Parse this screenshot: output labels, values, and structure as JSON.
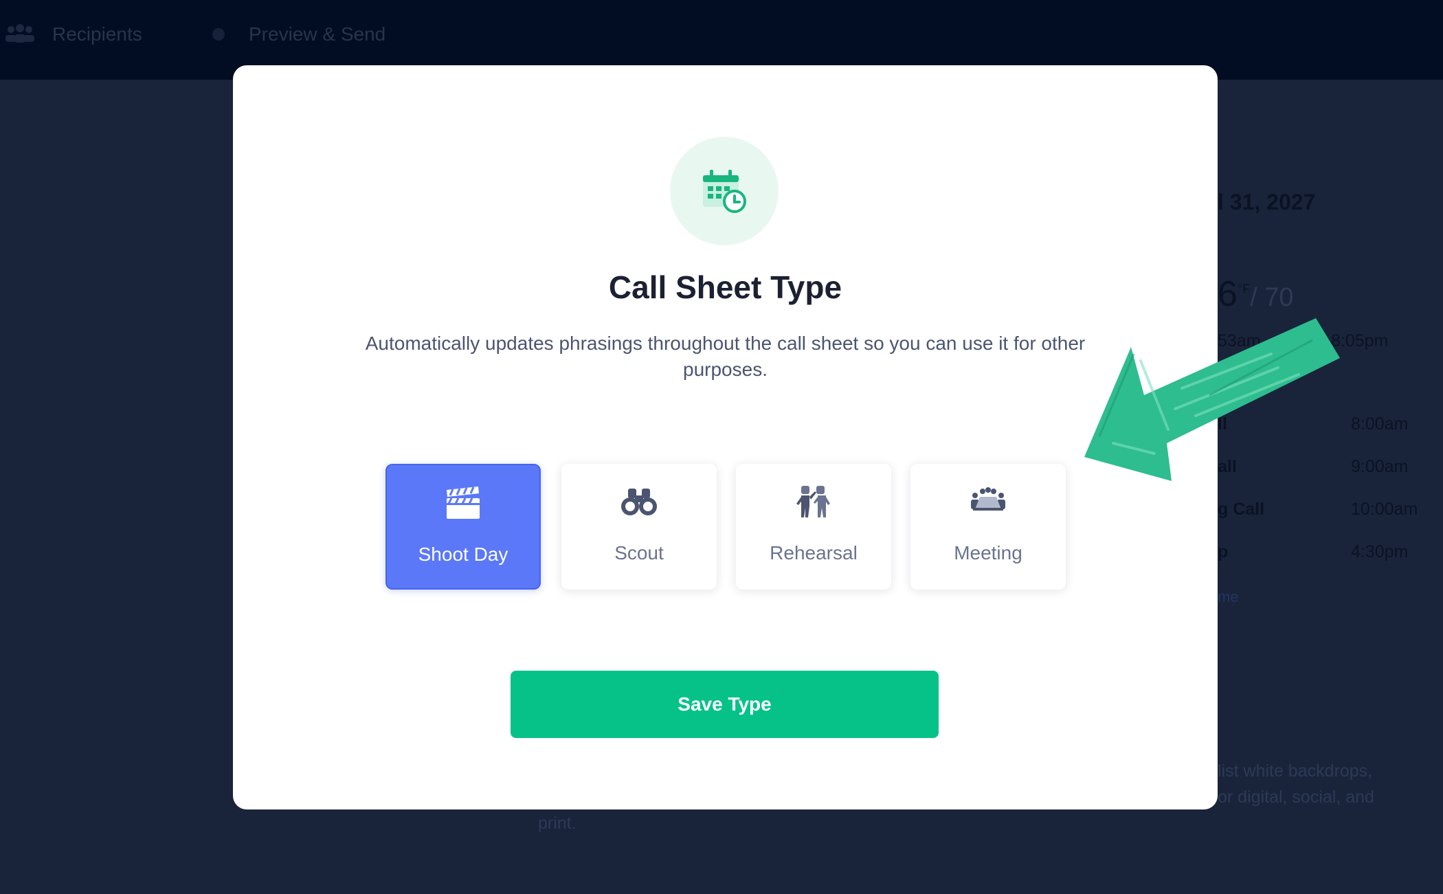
{
  "topbar": {
    "steps": [
      {
        "label": "Recipients",
        "icon": "people-icon"
      },
      {
        "label": "Preview & Send",
        "icon": "dot-icon"
      }
    ]
  },
  "background": {
    "date_fragment": "l 31, 2027",
    "temp_main": "6",
    "temp_unit": "°F",
    "temp_low": "/ 70",
    "sunrise": "53am",
    "sunset": "8:05pm",
    "schedule": [
      {
        "label": "ll",
        "time": "8:00am"
      },
      {
        "label": "all",
        "time": "9:00am"
      },
      {
        "label": "g Call",
        "time": "10:00am"
      },
      {
        "label": "p",
        "time": "4:30pm"
      }
    ],
    "link_fragment": "me",
    "notes_line1": "list white backdrops,",
    "notes_line2": "or digital, social, and",
    "notes_line3": "print."
  },
  "modal": {
    "icon": "calendar-clock-icon",
    "title": "Call Sheet Type",
    "description": "Automatically updates phrasings throughout the call sheet so you can use it for other purposes.",
    "options": [
      {
        "label": "Shoot Day",
        "icon": "clapperboard-icon",
        "selected": true
      },
      {
        "label": "Scout",
        "icon": "binoculars-icon",
        "selected": false
      },
      {
        "label": "Rehearsal",
        "icon": "actors-icon",
        "selected": false
      },
      {
        "label": "Meeting",
        "icon": "meeting-icon",
        "selected": false
      }
    ],
    "save_label": "Save Type"
  },
  "colors": {
    "accent_blue": "#5a78f8",
    "save_green": "#06c289",
    "annotation_arrow": "#2ebd8e"
  }
}
